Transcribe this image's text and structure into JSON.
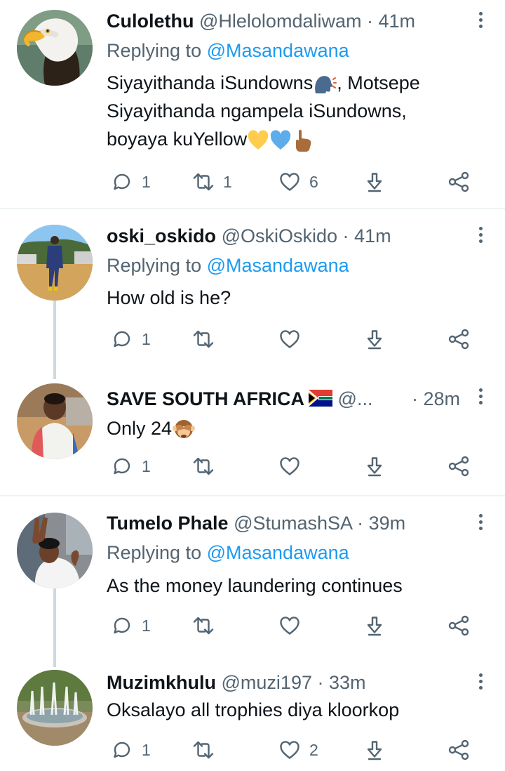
{
  "tweets": [
    {
      "name": "Culolethu",
      "handle": "@Hlelolomdaliwam",
      "time": "· 41m",
      "replying_label": "Replying to",
      "replying_to": "@Masandawana",
      "lines": [
        "Siyayithanda iSundowns",
        ", Motsepe",
        "Siyayithanda ngampela iSundowns,",
        "boyaya kuYellow"
      ],
      "counts": {
        "reply": "1",
        "retweet": "1",
        "like": "6"
      },
      "avatar": "bald-eagle"
    },
    {
      "name": "oski_oskido",
      "handle": "@OskiOskido",
      "time": "· 41m",
      "replying_label": "Replying to",
      "replying_to": "@Masandawana",
      "lines": [
        "How old is he?"
      ],
      "counts": {
        "reply": "1",
        "retweet": "",
        "like": ""
      },
      "avatar": "man-in-suit-outdoors"
    },
    {
      "name": "SAVE SOUTH AFRICA",
      "handle": "@...",
      "time": "· 28m",
      "lines": [
        "Only 24"
      ],
      "counts": {
        "reply": "1",
        "retweet": "",
        "like": ""
      },
      "avatar": "person-portrait"
    },
    {
      "name": "Tumelo Phale",
      "handle": "@StumashSA",
      "time": "· 39m",
      "replying_label": "Replying to",
      "replying_to": "@Masandawana",
      "lines": [
        "As the money laundering continues"
      ],
      "counts": {
        "reply": "1",
        "retweet": "",
        "like": ""
      },
      "avatar": "peace-sign-selfie"
    },
    {
      "name": "Muzimkhulu",
      "handle": "@muzi197",
      "time": "· 33m",
      "lines": [
        "Oksalayo all trophies diya kloorkop"
      ],
      "counts": {
        "reply": "1",
        "retweet": "",
        "like": "2"
      },
      "avatar": "fountain"
    }
  ],
  "icons": {
    "reply": "reply-icon",
    "retweet": "retweet-icon",
    "like": "heart-icon",
    "share": "share-icon",
    "download": "download-icon",
    "more": "more-icon"
  },
  "colors": {
    "text": "#0f1419",
    "secondary": "#536471",
    "link": "#1d9bf0",
    "thread_line": "#cfd9de",
    "divider": "#eff3f4"
  }
}
